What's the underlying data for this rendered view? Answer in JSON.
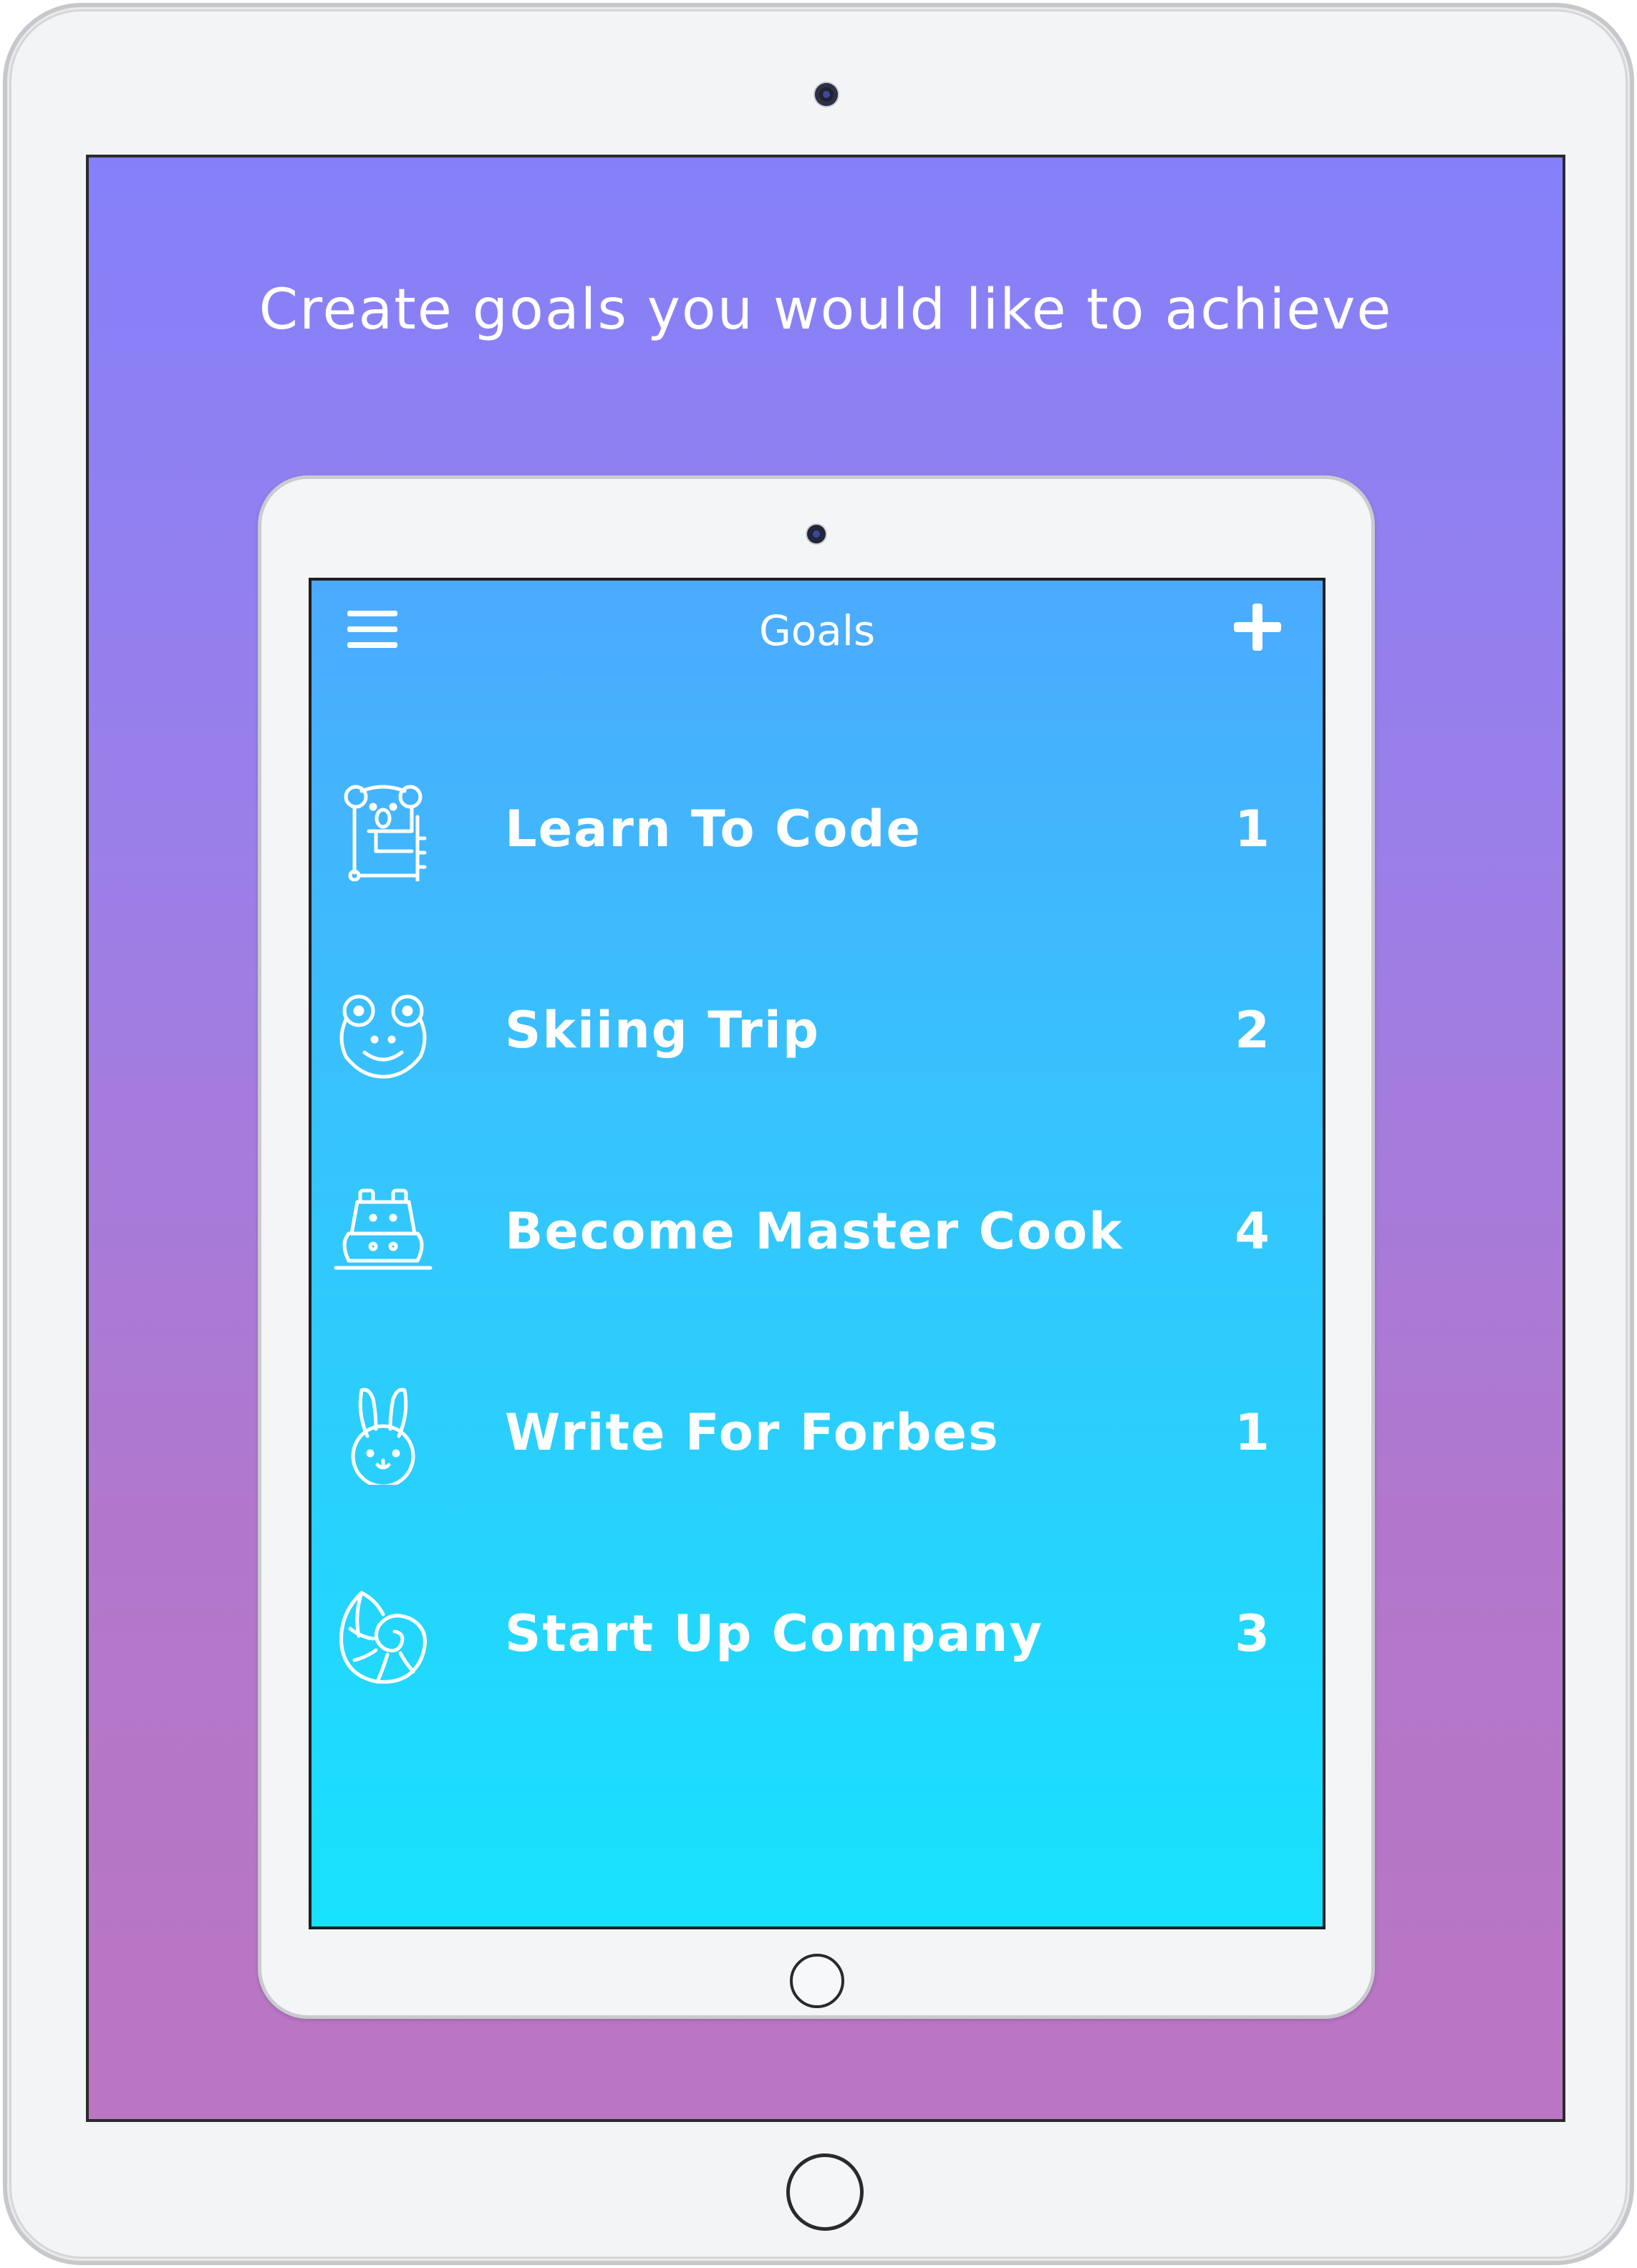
{
  "promo": {
    "tagline": "Create goals you would like to achieve"
  },
  "app": {
    "nav": {
      "title": "Goals",
      "menu_icon": "hamburger-menu-icon",
      "add_icon": "plus-icon"
    },
    "goals": [
      {
        "label": "Learn To Code",
        "count": "1",
        "icon": "koala-icon"
      },
      {
        "label": "Skiing Trip",
        "count": "2",
        "icon": "frog-icon"
      },
      {
        "label": "Become Master Cook",
        "count": "4",
        "icon": "hippo-icon"
      },
      {
        "label": "Write For Forbes",
        "count": "1",
        "icon": "bunny-icon"
      },
      {
        "label": "Start Up Company",
        "count": "3",
        "icon": "seashell-icon"
      }
    ]
  },
  "colors": {
    "promo_gradient_top": "#8580fa",
    "promo_gradient_bottom": "#ba76c2",
    "screen_gradient_top": "#4caafd",
    "screen_gradient_bottom": "#17e2fd",
    "text": "#ffffff"
  }
}
